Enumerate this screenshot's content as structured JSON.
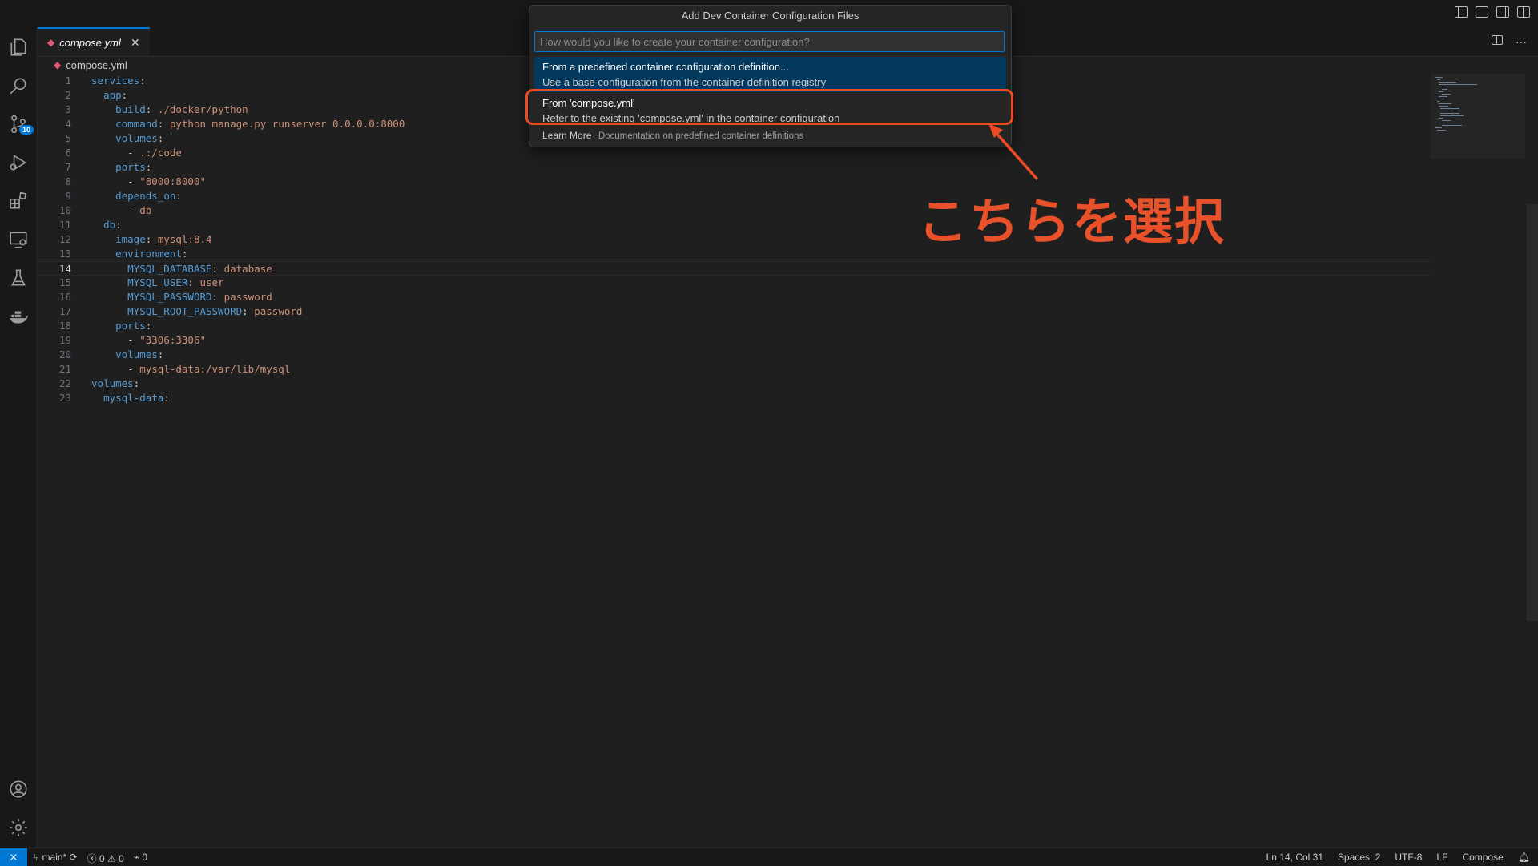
{
  "editor_tab": {
    "label": "compose.yml",
    "close": "✕"
  },
  "breadcrumb": {
    "file": "compose.yml"
  },
  "activity": {
    "scm_badge": "10"
  },
  "code_lines": [
    [
      [
        "k",
        "services"
      ],
      [
        "p",
        ":"
      ]
    ],
    [
      [
        "p",
        "  "
      ],
      [
        "k",
        "app"
      ],
      [
        "p",
        ":"
      ]
    ],
    [
      [
        "p",
        "    "
      ],
      [
        "k",
        "build"
      ],
      [
        "p",
        ": "
      ],
      [
        "v",
        "./docker/python"
      ]
    ],
    [
      [
        "p",
        "    "
      ],
      [
        "k",
        "command"
      ],
      [
        "p",
        ": "
      ],
      [
        "v",
        "python manage.py runserver 0.0.0.0:8000"
      ]
    ],
    [
      [
        "p",
        "    "
      ],
      [
        "k",
        "volumes"
      ],
      [
        "p",
        ":"
      ]
    ],
    [
      [
        "p",
        "      - "
      ],
      [
        "v",
        ".:/code"
      ]
    ],
    [
      [
        "p",
        "    "
      ],
      [
        "k",
        "ports"
      ],
      [
        "p",
        ":"
      ]
    ],
    [
      [
        "p",
        "      - "
      ],
      [
        "v",
        "\"8000:8000\""
      ]
    ],
    [
      [
        "p",
        "    "
      ],
      [
        "k",
        "depends_on"
      ],
      [
        "p",
        ":"
      ]
    ],
    [
      [
        "p",
        "      - "
      ],
      [
        "v",
        "db"
      ]
    ],
    [
      [
        "p",
        "  "
      ],
      [
        "k",
        "db"
      ],
      [
        "p",
        ":"
      ]
    ],
    [
      [
        "p",
        "    "
      ],
      [
        "k",
        "image"
      ],
      [
        "p",
        ": "
      ],
      [
        "vu",
        "mysql"
      ],
      [
        "v",
        ":8.4"
      ]
    ],
    [
      [
        "p",
        "    "
      ],
      [
        "k",
        "environment"
      ],
      [
        "p",
        ":"
      ]
    ],
    [
      [
        "p",
        "      "
      ],
      [
        "k",
        "MYSQL_DATABASE"
      ],
      [
        "p",
        ": "
      ],
      [
        "v",
        "database"
      ]
    ],
    [
      [
        "p",
        "      "
      ],
      [
        "k",
        "MYSQL_USER"
      ],
      [
        "p",
        ": "
      ],
      [
        "v",
        "user"
      ]
    ],
    [
      [
        "p",
        "      "
      ],
      [
        "k",
        "MYSQL_PASSWORD"
      ],
      [
        "p",
        ": "
      ],
      [
        "v",
        "password"
      ]
    ],
    [
      [
        "p",
        "      "
      ],
      [
        "k",
        "MYSQL_ROOT_PASSWORD"
      ],
      [
        "p",
        ": "
      ],
      [
        "v",
        "password"
      ]
    ],
    [
      [
        "p",
        "    "
      ],
      [
        "k",
        "ports"
      ],
      [
        "p",
        ":"
      ]
    ],
    [
      [
        "p",
        "      - "
      ],
      [
        "v",
        "\"3306:3306\""
      ]
    ],
    [
      [
        "p",
        "    "
      ],
      [
        "k",
        "volumes"
      ],
      [
        "p",
        ":"
      ]
    ],
    [
      [
        "p",
        "      - "
      ],
      [
        "v",
        "mysql-data:/var/lib/mysql"
      ]
    ],
    [
      [
        "k",
        "volumes"
      ],
      [
        "p",
        ":"
      ]
    ],
    [
      [
        "p",
        "  "
      ],
      [
        "k",
        "mysql-data"
      ],
      [
        "p",
        ":"
      ]
    ]
  ],
  "current_line": 14,
  "quick_pick": {
    "title": "Add Dev Container Configuration Files",
    "placeholder": "How would you like to create your container configuration?",
    "items": [
      {
        "label": "From a predefined container configuration definition...",
        "description": "Use a base configuration from the container definition registry"
      },
      {
        "label": "From 'compose.yml'",
        "description": "Refer to the existing 'compose.yml' in the container configuration"
      }
    ],
    "learn_more": {
      "label": "Learn More",
      "description": "Documentation on predefined container definitions"
    }
  },
  "annotation": {
    "text": "こちらを選択",
    "color": "#e8512a"
  },
  "status_bar": {
    "branch": "main*",
    "errors": "0",
    "warnings": "0",
    "ports": "0",
    "position": "Ln 14, Col 31",
    "spaces": "Spaces: 2",
    "encoding": "UTF-8",
    "eol": "LF",
    "language": "Compose"
  },
  "colors": {
    "accent": "#0078d4",
    "selection": "#04395e",
    "annotation": "#ea4a24"
  }
}
